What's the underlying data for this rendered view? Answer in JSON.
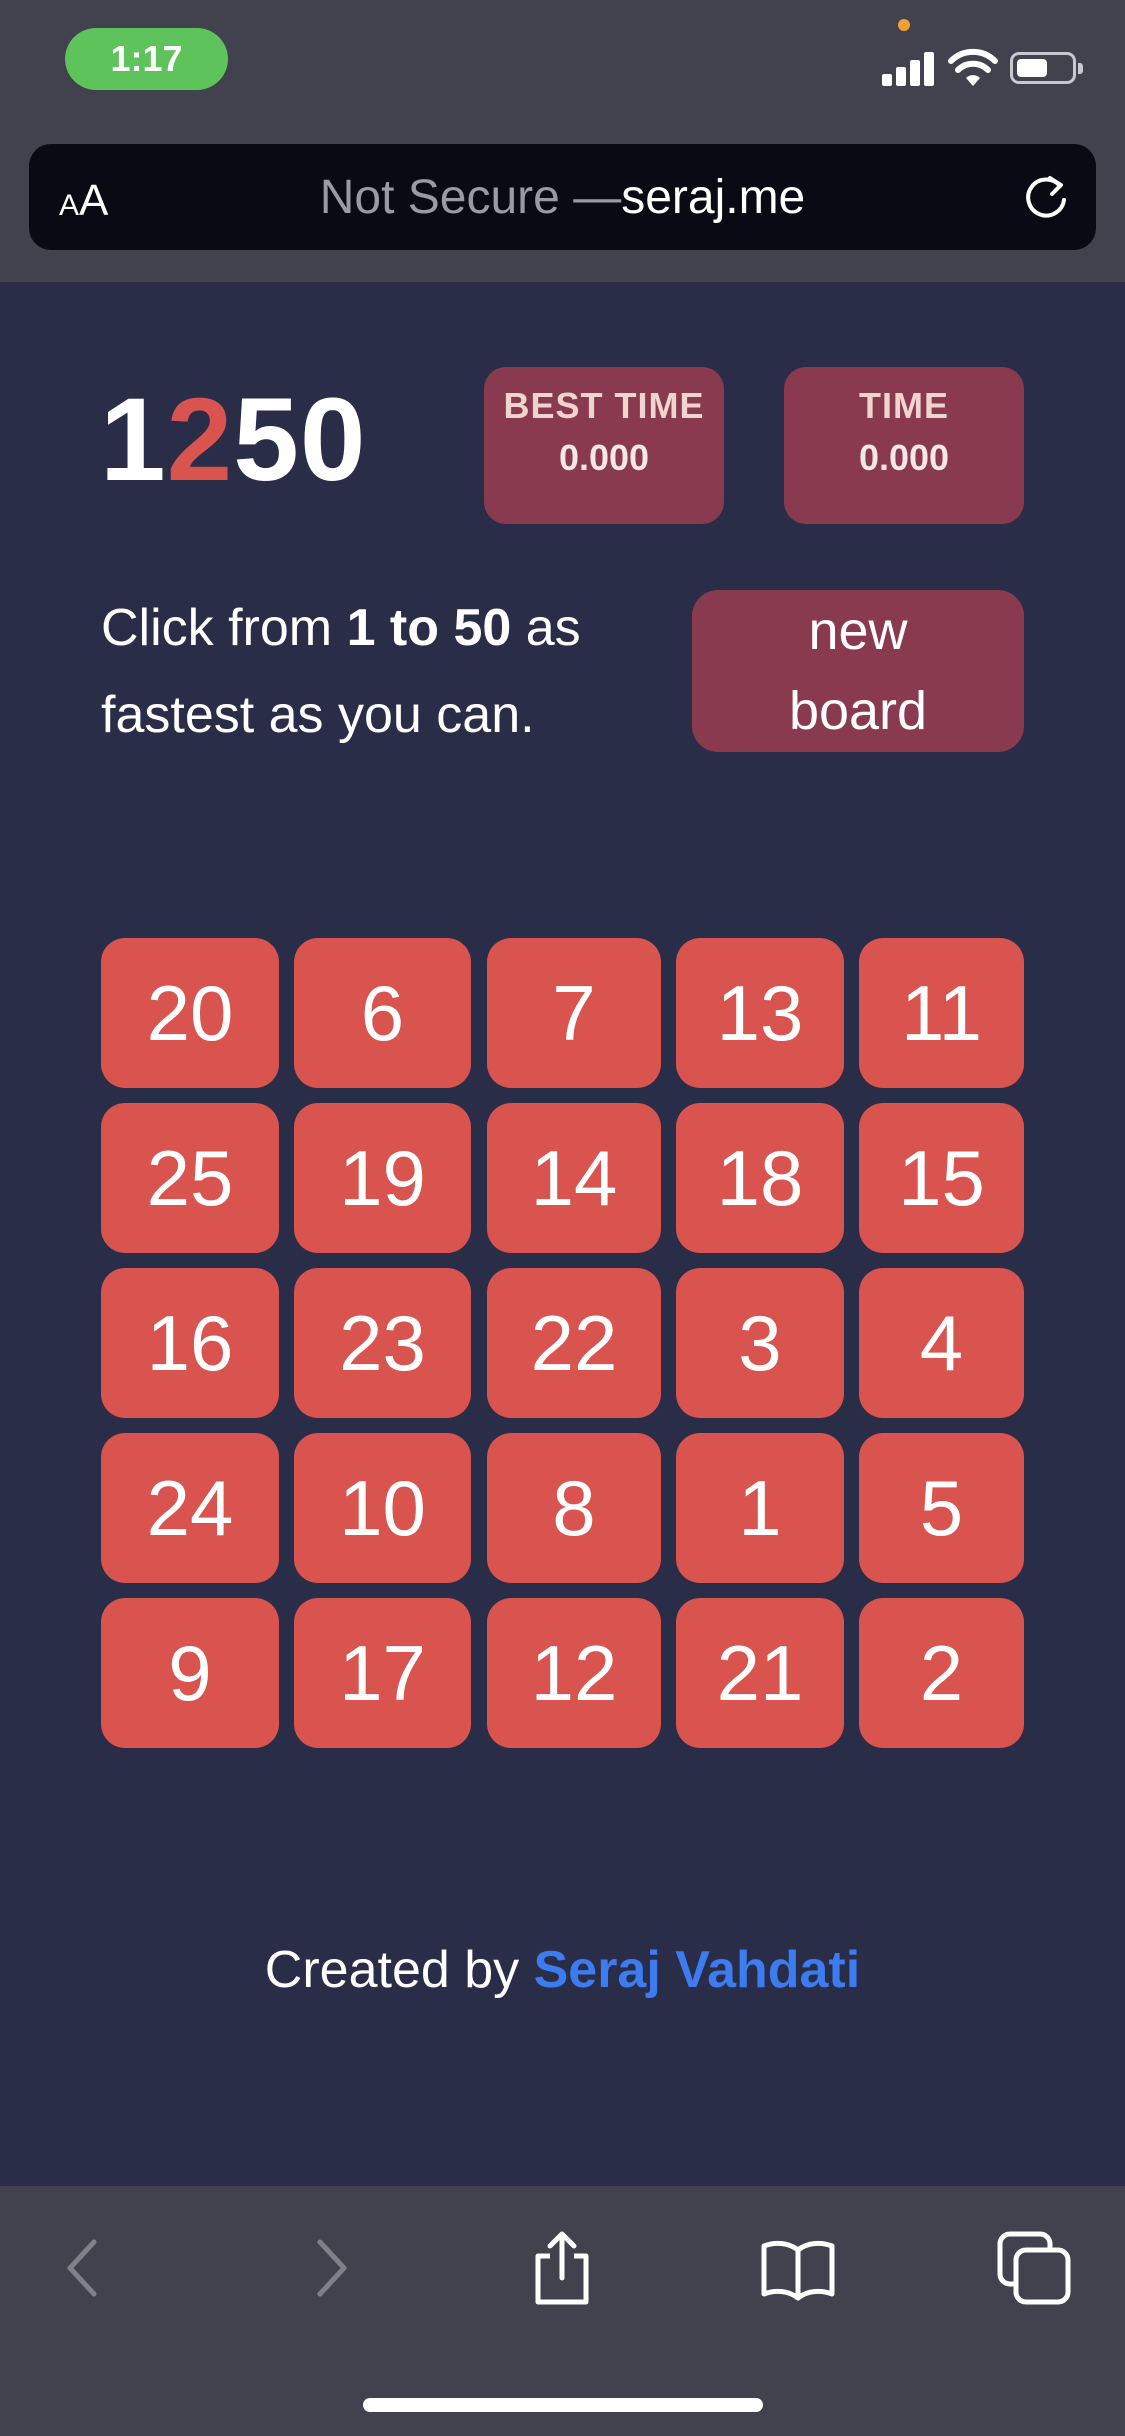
{
  "status_bar": {
    "time": "1:17"
  },
  "browser": {
    "reader_small": "A",
    "reader_big": "A",
    "not_secure": "Not Secure — ",
    "host": "seraj.me"
  },
  "game": {
    "logo_1": "1",
    "logo_2": "2",
    "logo_rest": "50",
    "best_time_label": "BEST TIME",
    "best_time_value": "0.000",
    "time_label": "TIME",
    "time_value": "0.000",
    "instr_pre": "Click from ",
    "instr_bold": "1 to 50",
    "instr_post": " as fastest as you can.",
    "new_board": "new board",
    "accent": "#d9534f",
    "panel": "#8a3a4e",
    "board": [
      [
        "20",
        "6",
        "7",
        "13",
        "11"
      ],
      [
        "25",
        "19",
        "14",
        "18",
        "15"
      ],
      [
        "16",
        "23",
        "22",
        "3",
        "4"
      ],
      [
        "24",
        "10",
        "8",
        "1",
        "5"
      ],
      [
        "9",
        "17",
        "12",
        "21",
        "2"
      ]
    ]
  },
  "footer": {
    "created_by": "Created by ",
    "author": "Seraj Vahdati"
  },
  "toolbar_icons": [
    "back-icon",
    "forward-icon",
    "share-icon",
    "bookmarks-icon",
    "tabs-icon"
  ]
}
